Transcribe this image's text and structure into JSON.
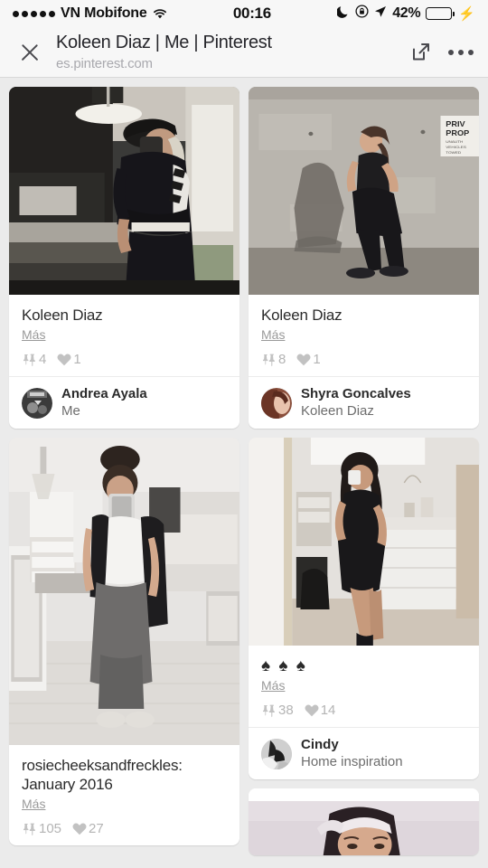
{
  "status_bar": {
    "signal_dots": 5,
    "carrier": "VN Mobifone",
    "wifi_icon": "wifi-icon",
    "time": "00:16",
    "moon_icon": "moon-icon",
    "rotation_lock_icon": "rotation-lock-icon",
    "location_icon": "location-arrow-icon",
    "battery_percent": "42%",
    "battery_level": 42,
    "charging_icon": "lightning-bolt-icon",
    "battery_color": "#4cd964"
  },
  "navbar": {
    "close_icon": "close-icon",
    "title": "Koleen Diaz | Me | Pinterest",
    "url": "es.pinterest.com",
    "share_icon": "share-external-link-icon",
    "more_icon": "more-options-icon"
  },
  "more_label": "Más",
  "pins": [
    {
      "title": "Koleen Diaz",
      "more_label": "Más",
      "repins": "4",
      "likes": "1",
      "author": "Andrea Ayala",
      "board": "Me",
      "image_alt": "mirror-selfie-dark-kitchen",
      "column": "left"
    },
    {
      "title": "Koleen Diaz",
      "more_label": "Más",
      "repins": "8",
      "likes": "1",
      "author": "Shyra Goncalves",
      "board": "Koleen Diaz",
      "image_alt": "woman-against-concrete-wall",
      "column": "right"
    },
    {
      "title": "rosiecheeksandfreckles: January 2016",
      "more_label": "Más",
      "repins": "105",
      "likes": "27",
      "author": "",
      "board": "",
      "image_alt": "mirror-selfie-white-bedroom",
      "column": "left"
    },
    {
      "title": "♠ ♠ ♠",
      "more_label": "Más",
      "repins": "38",
      "likes": "14",
      "author": "Cindy",
      "board": "Home inspiration",
      "image_alt": "woman-black-dress-bedroom",
      "column": "right"
    },
    {
      "title": "",
      "more_label": "",
      "repins": "",
      "likes": "",
      "author": "",
      "board": "",
      "image_alt": "woman-portrait-partial",
      "column": "right"
    }
  ],
  "colors": {
    "page_background": "#ebebeb",
    "card_background": "#ffffff",
    "header_background": "#f7f7f7",
    "title_text": "#2b2b2b",
    "muted_text": "#9a9a9a",
    "stat_text": "#b4b4b4"
  }
}
